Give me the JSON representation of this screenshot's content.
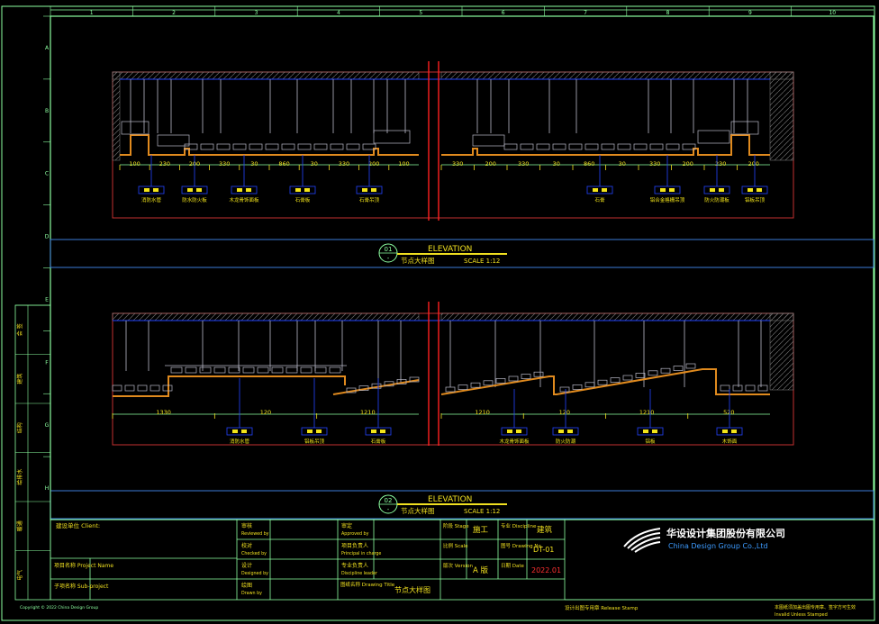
{
  "grid": {
    "columns": [
      "1",
      "2",
      "3",
      "4",
      "5",
      "6",
      "7",
      "8",
      "9",
      "10"
    ],
    "rows": [
      "A",
      "B",
      "C",
      "D",
      "E",
      "F",
      "G",
      "H"
    ]
  },
  "detail1": {
    "number": "01",
    "title": "ELEVATION",
    "subtitle": "节点大样图",
    "scale": "SCALE 1:12",
    "dims_left": [
      "100",
      "230",
      "200",
      "330",
      "30",
      "860",
      "30",
      "330",
      "200",
      "100"
    ],
    "dims_right": [
      "330",
      "200",
      "330",
      "30",
      "860",
      "30",
      "330",
      "200",
      "230",
      "200"
    ],
    "tags_left": [
      "消防水管",
      "防水防火板",
      "木龙骨饰面板",
      "石膏板",
      "石膏吊顶"
    ],
    "tags_right": [
      "石膏",
      "铝合金格栅吊顶",
      "防火防潮板",
      "铝板吊顶"
    ]
  },
  "detail2": {
    "number": "02",
    "title": "ELEVATION",
    "subtitle": "节点大样图",
    "scale": "SCALE 1:12",
    "dims_left": [
      "1330",
      "120",
      "1210"
    ],
    "dims_right": [
      "1210",
      "120",
      "1210",
      "520"
    ],
    "tags_left": [
      "消防水管",
      "铝板吊顶",
      "石膏板"
    ],
    "tags_right": [
      "木龙骨饰面板",
      "防火防潮",
      "铝板",
      "木饰面"
    ]
  },
  "title_block": {
    "client_label": "建设单位 Client:",
    "project_label": "项目名称 Project Name",
    "subproject_label": "子项名称 Sub-project",
    "mid_labels": [
      {
        "cn": "审核",
        "en": "Reviewed by"
      },
      {
        "cn": "校对",
        "en": "Checked by"
      },
      {
        "cn": "设计",
        "en": "Designed by"
      },
      {
        "cn": "绘图",
        "en": "Drawn by"
      }
    ],
    "right_labels": [
      {
        "cn": "审定",
        "en": "Approved by"
      },
      {
        "cn": "项目负责人",
        "en": "Principal in charge"
      },
      {
        "cn": "专业负责人",
        "en": "Discipline leader"
      }
    ],
    "drawing_title_label": "图纸名称 Drawing Title",
    "drawing_title": "节点大样图",
    "stage_label": "阶段 Stage",
    "stage": "施工",
    "discipline_label": "专业 Discipline",
    "discipline": "建筑",
    "scale_label": "比例 Scale",
    "drawing_no_label": "图号 Drawing No.",
    "drawing_no": "DT-01",
    "version_label": "版次 Version",
    "version": "A 版",
    "date_label": "日期 Date",
    "date": "2022.01",
    "company_cn": "华设设计集团股份有限公司",
    "company_en": "China Design Group Co.,Ltd",
    "stamp_label": "设计出图专用章 Release Stamp",
    "note_cn": "本图纸须加盖出图专用章、签字方可生效",
    "note_en": "Invalid Unless Stamped",
    "copyright": "Copyright © 2022 China Design Group",
    "left_strip": [
      "会 签",
      "建筑",
      "结构",
      "给排水",
      "暖通",
      "电气"
    ]
  },
  "colors": {
    "background": "#000000",
    "frame": "#8cffa0",
    "grid": "#3d7bd9",
    "concrete": "#c23030",
    "gypsum": "#e08a1e",
    "hanger": "#b9b9c8",
    "tag_box": "#2244ff",
    "tag_text": "#f2e41a",
    "title_text": "#f0e020",
    "section_line": "#ff2020"
  }
}
